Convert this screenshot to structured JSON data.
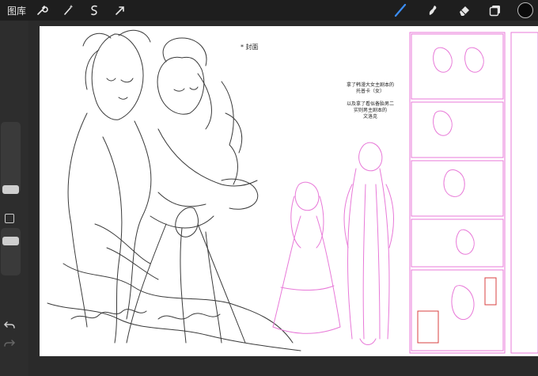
{
  "toolbar": {
    "gallery_label": "图库",
    "left_tools": [
      "wrench-icon",
      "magic-wand-icon",
      "selection-icon",
      "transform-arrow-icon"
    ],
    "right_tools": [
      "brush-icon",
      "smudge-icon",
      "eraser-icon",
      "layers-icon"
    ],
    "current_color": "#0a0a0a",
    "active_tool_color": "#3b8df5"
  },
  "canvas": {
    "cover_note": "* 封面",
    "notes": [
      "拿了韩漫大女主剧本的",
      "托普卡（女）",
      "",
      "以及拿了看似备胎男二",
      "实则男主剧本的",
      "文洛克"
    ],
    "sketch_colors": {
      "pencil": "#3a3a3a",
      "pink": "#e879d8",
      "red_box": "#d94040"
    }
  }
}
